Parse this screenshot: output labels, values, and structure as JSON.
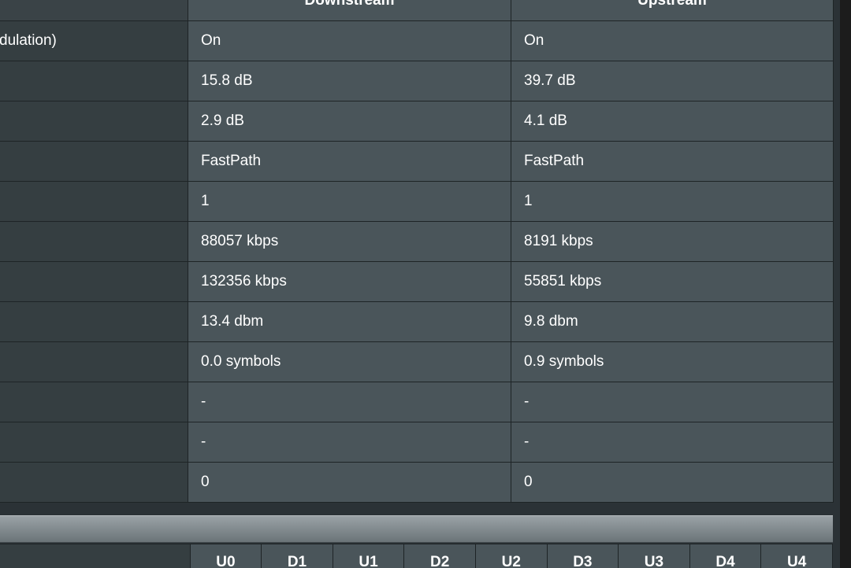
{
  "stats": {
    "columns": {
      "downstream": "Downstream",
      "upstream": "Upstream"
    },
    "rows": [
      {
        "label": "dulation)",
        "down": "On",
        "up": "On"
      },
      {
        "label": "",
        "down": "15.8 dB",
        "up": "39.7 dB"
      },
      {
        "label": "",
        "down": "2.9 dB",
        "up": "4.1 dB"
      },
      {
        "label": "",
        "down": "FastPath",
        "up": "FastPath"
      },
      {
        "label": "",
        "down": "1",
        "up": "1"
      },
      {
        "label": "",
        "down": "88057 kbps",
        "up": "8191 kbps"
      },
      {
        "label": "",
        "down": "132356 kbps",
        "up": "55851 kbps"
      },
      {
        "label": "",
        "down": "13.4 dbm",
        "up": "9.8 dbm"
      },
      {
        "label": "",
        "down": "0.0 symbols",
        "up": "0.9 symbols"
      },
      {
        "label": "",
        "down": "-",
        "up": "-"
      },
      {
        "label": "",
        "down": "-",
        "up": "-"
      },
      {
        "label": "",
        "down": "0",
        "up": "0"
      }
    ]
  },
  "bands": {
    "headers": [
      "U0",
      "D1",
      "U1",
      "D2",
      "U2",
      "D3",
      "U3",
      "D4",
      "U4"
    ]
  }
}
